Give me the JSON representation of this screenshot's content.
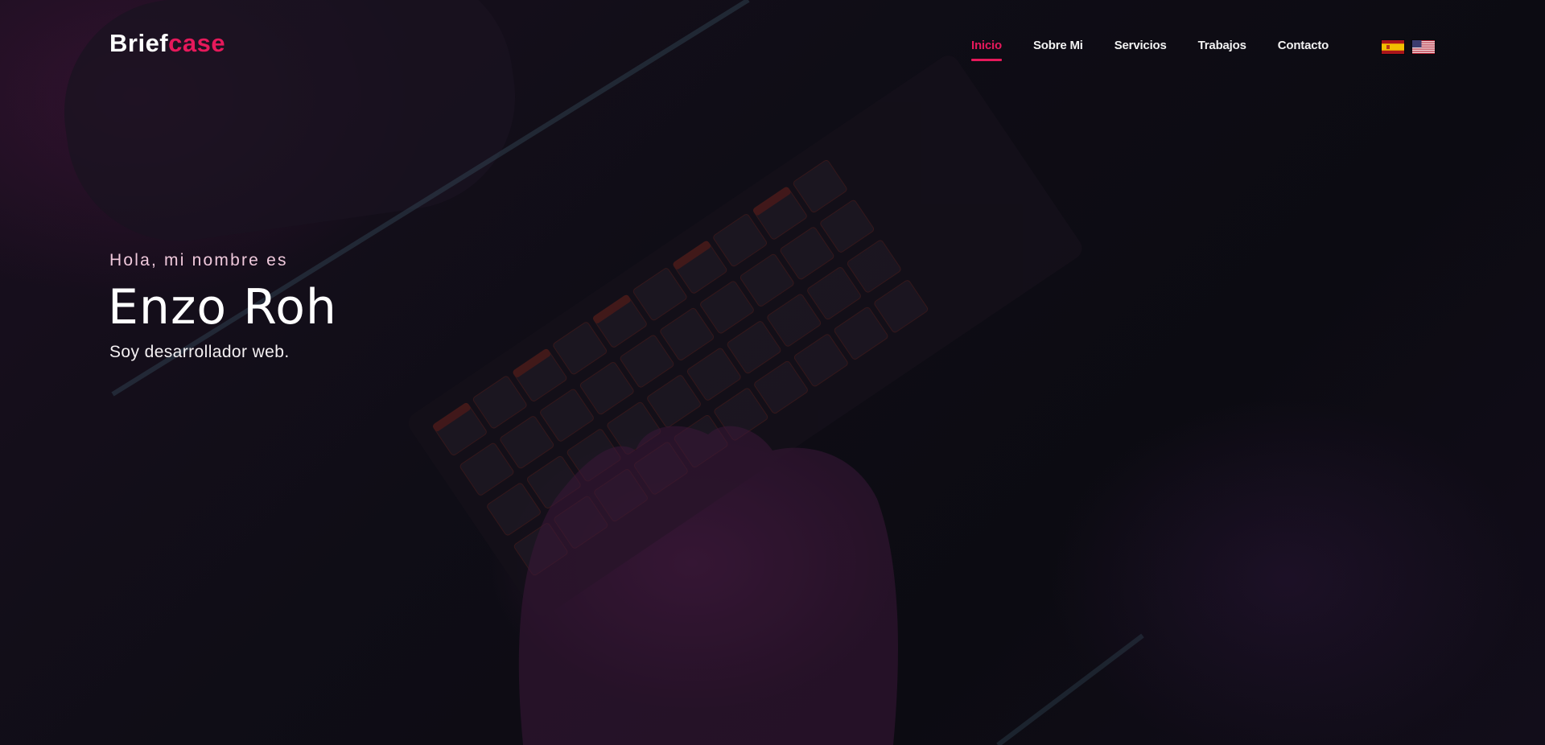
{
  "brand": {
    "name_part1": "Brief",
    "name_part2": "case"
  },
  "nav": {
    "items": [
      {
        "label": "Inicio",
        "active": true
      },
      {
        "label": "Sobre Mi",
        "active": false
      },
      {
        "label": "Servicios",
        "active": false
      },
      {
        "label": "Trabajos",
        "active": false
      },
      {
        "label": "Contacto",
        "active": false
      }
    ],
    "languages": [
      {
        "icon": "spain-flag-icon"
      },
      {
        "icon": "usa-flag-icon"
      }
    ]
  },
  "hero": {
    "greeting": "Hola, mi nombre es",
    "name": "Enzo Roh",
    "tagline": "Soy desarrollador web."
  },
  "colors": {
    "accent": "#e6195b",
    "background": "#0e0c14",
    "text": "#ffffff"
  }
}
